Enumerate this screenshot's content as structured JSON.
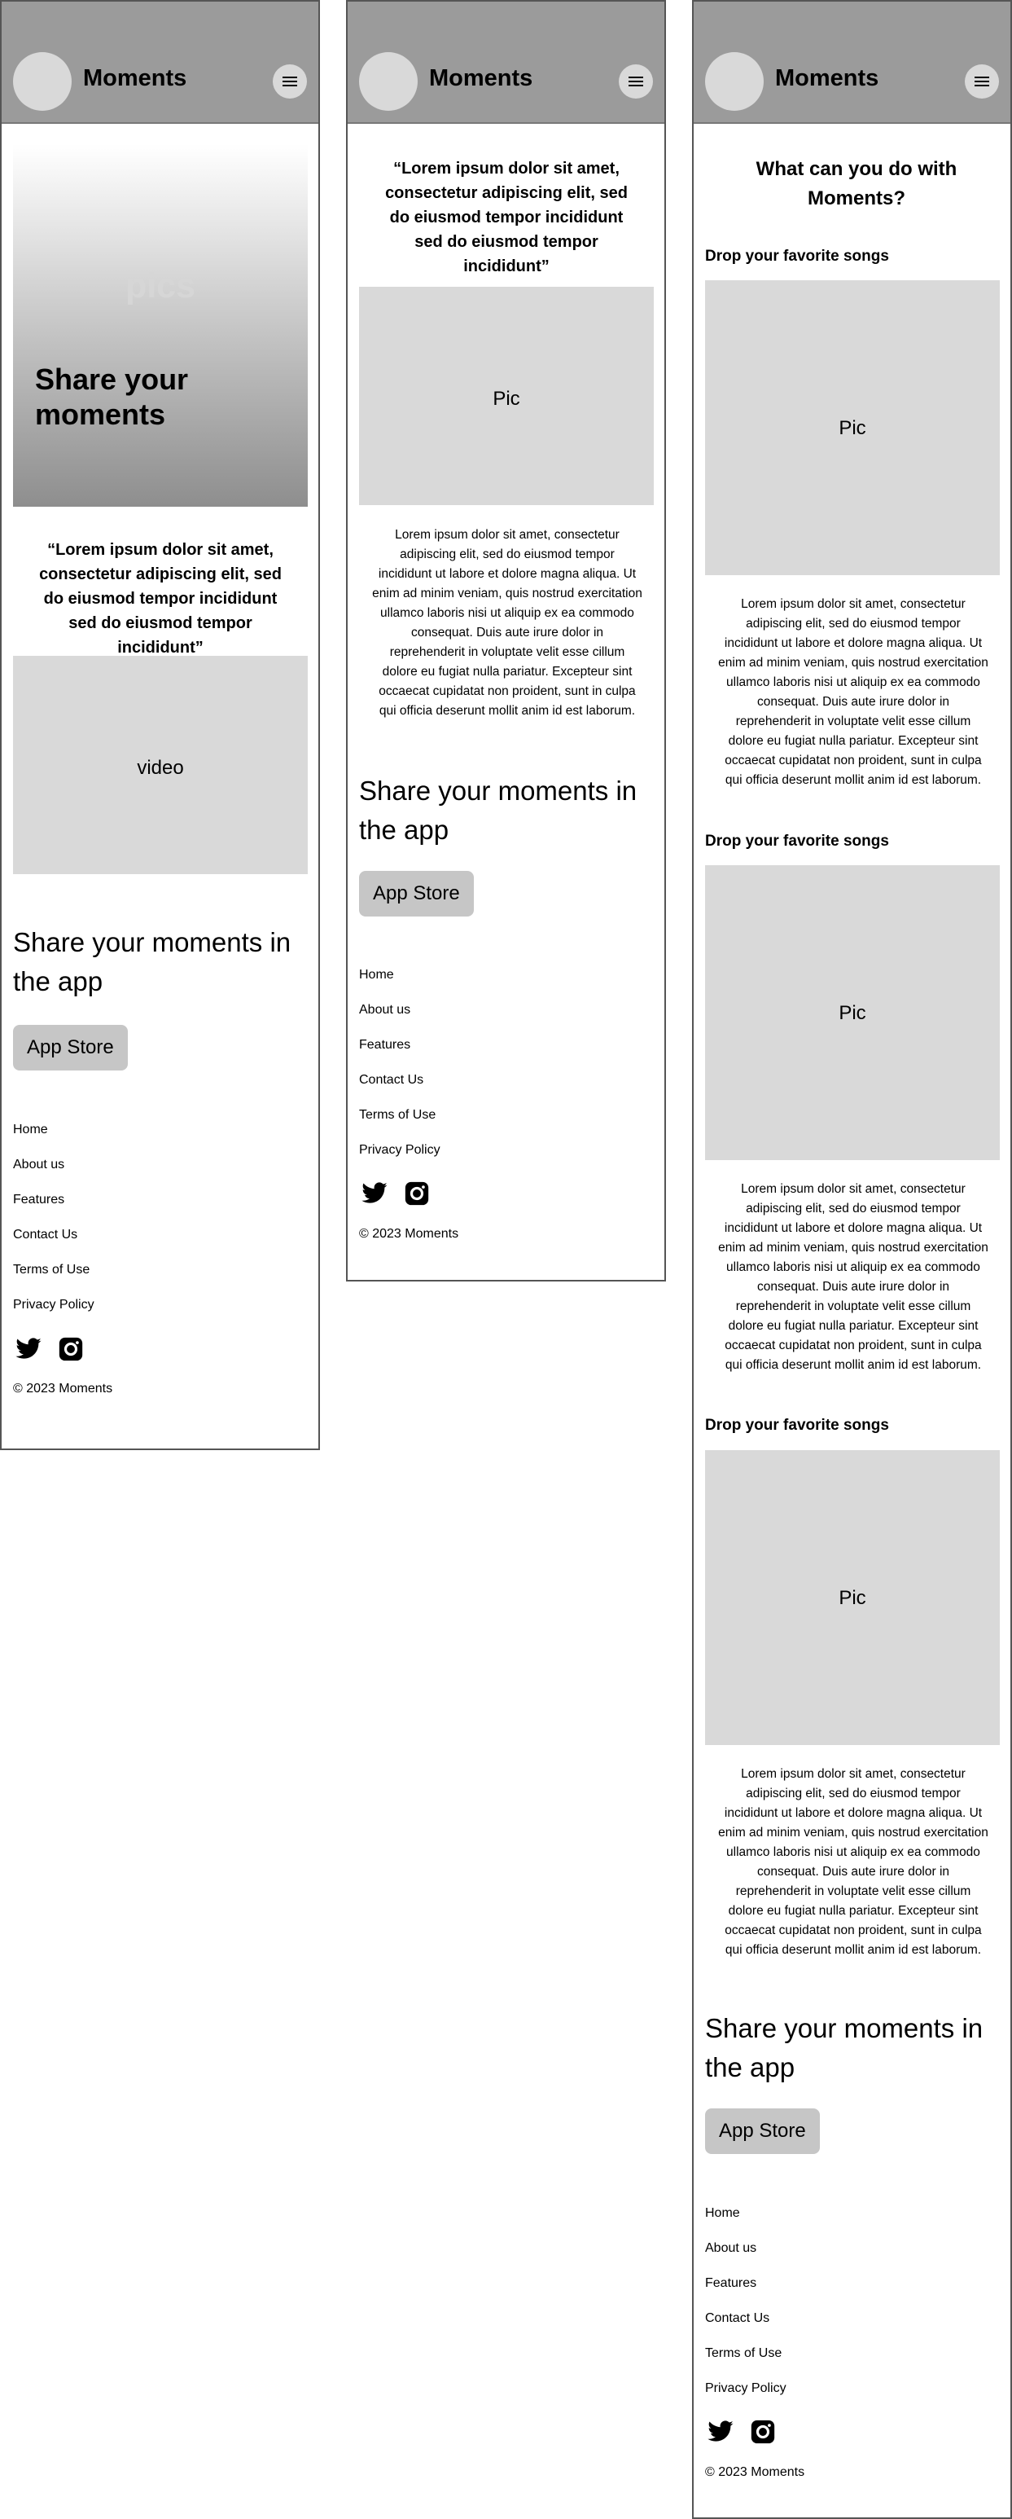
{
  "brand": "Moments",
  "hero": {
    "background_label": "pics",
    "title": "Share your moments"
  },
  "quote": "“Lorem ipsum dolor sit amet, consectetur adipiscing elit, sed do eiusmod tempor incididunt sed do eiusmod tempor incididunt”",
  "video_label": "video",
  "pic_label": "Pic",
  "lorem": "Lorem ipsum dolor sit amet, consectetur adipiscing elit, sed do eiusmod tempor incididunt ut labore et dolore magna aliqua. Ut enim ad minim veniam, quis nostrud exercitation ullamco laboris nisi ut aliquip ex ea commodo consequat. Duis aute irure dolor in reprehenderit in voluptate velit esse cillum dolore eu fugiat nulla pariatur. Excepteur sint occaecat cupidatat non proident, sunt in culpa qui officia deserunt mollit anim id est laborum.",
  "features": {
    "heading": "What can you do with Moments?",
    "items": [
      {
        "title": "Drop your favorite songs"
      },
      {
        "title": "Drop your favorite songs"
      },
      {
        "title": "Drop your favorite songs"
      }
    ]
  },
  "promo": {
    "text": "Share your moments in the app",
    "button": "App Store"
  },
  "footer": {
    "links": [
      "Home",
      "About us",
      "Features",
      "Contact Us",
      "Terms of Use",
      "Privacy Policy"
    ],
    "copyright": "© 2023 Moments",
    "social_icons": [
      "twitter-icon",
      "instagram-icon"
    ]
  },
  "colors": {
    "header": "#9b9b9b",
    "placeholder": "#d9d9d9",
    "button": "#c6c6c6"
  }
}
